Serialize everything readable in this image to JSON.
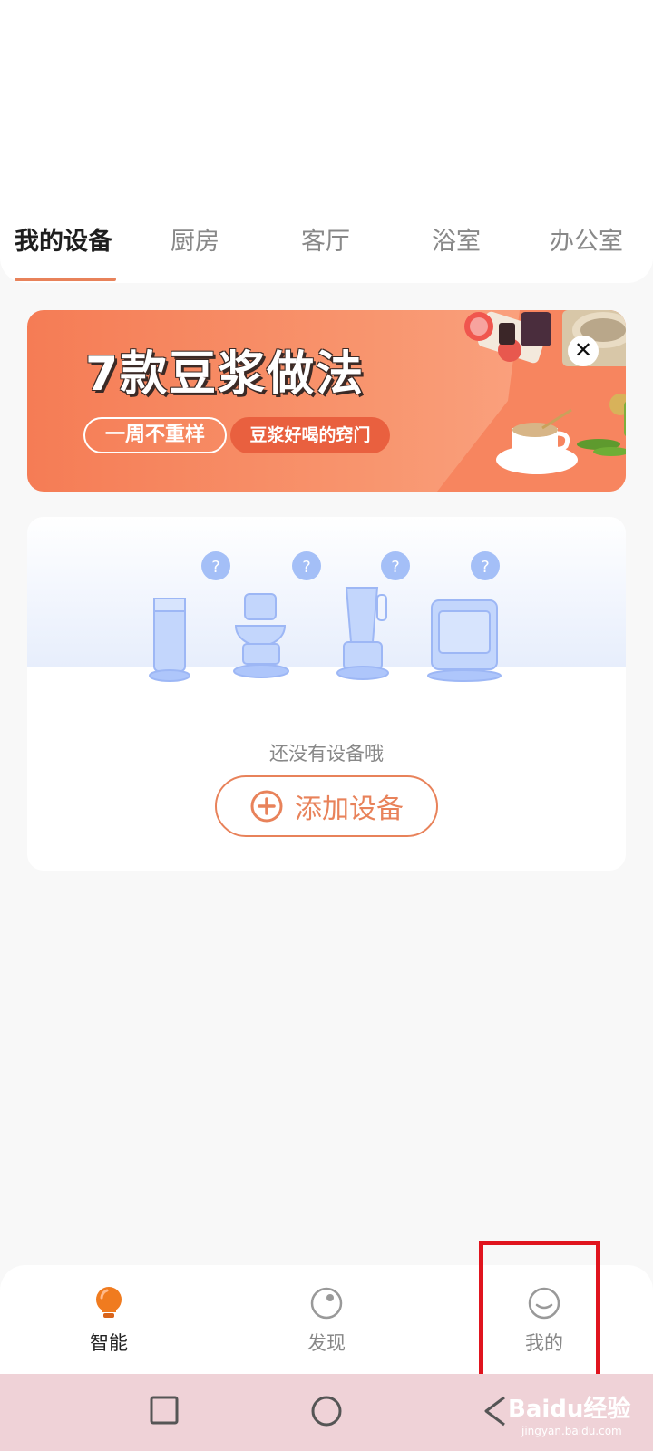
{
  "tabs": {
    "items": [
      {
        "label": "我的设备",
        "active": true
      },
      {
        "label": "厨房"
      },
      {
        "label": "客厅"
      },
      {
        "label": "浴室"
      },
      {
        "label": "办公室"
      }
    ]
  },
  "banner": {
    "title": "7款豆浆做法",
    "pill_outline": "一周不重样",
    "pill_solid": "豆浆好喝的窍门",
    "close_icon": "close-icon"
  },
  "empty_state": {
    "message": "还没有设备哦",
    "add_button_label": "添加设备",
    "add_icon": "plus-circle-icon",
    "question_mark": "?"
  },
  "bottom_nav": {
    "items": [
      {
        "label": "智能",
        "icon": "bulb-icon",
        "active": true
      },
      {
        "label": "发现",
        "icon": "discover-icon"
      },
      {
        "label": "我的",
        "icon": "profile-icon"
      }
    ]
  },
  "system_bar": {
    "buttons": [
      "recent-apps-icon",
      "home-icon",
      "back-icon"
    ]
  },
  "watermark": {
    "brand": "Baidu经验",
    "url": "jingyan.baidu.com"
  },
  "colors": {
    "accent": "#e8825a",
    "banner": "#f57c55",
    "highlight": "#e0141e",
    "system_bar": "#efd2d7"
  }
}
